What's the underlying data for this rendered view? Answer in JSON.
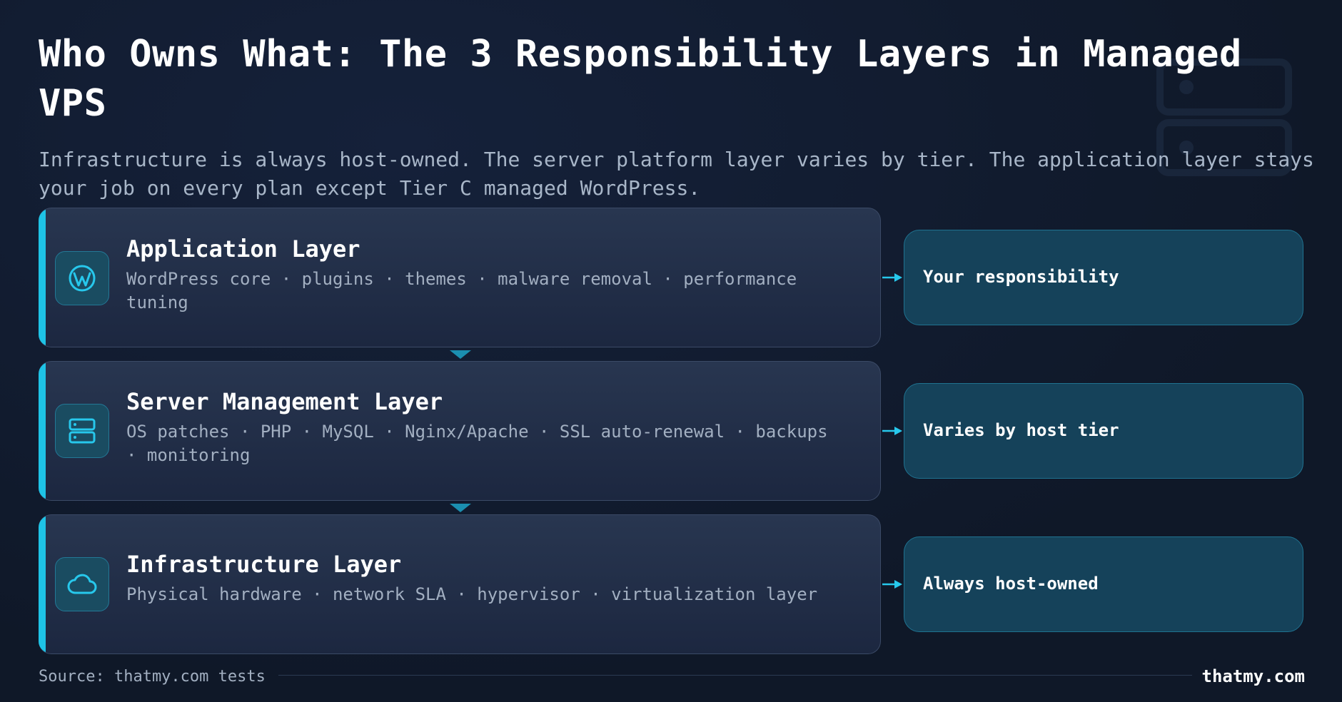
{
  "title": "Who Owns What: The 3 Responsibility Layers in Managed VPS",
  "subtitle": "Infrastructure is always host-owned. The server platform layer varies by tier. The application layer stays your job on every plan except Tier C managed WordPress.",
  "layers": [
    {
      "name": "Application Layer",
      "description": "WordPress core · plugins · themes · malware removal · performance tuning",
      "icon": "wordpress-icon",
      "owner": "Your responsibility"
    },
    {
      "name": "Server Management Layer",
      "description": "OS patches · PHP · MySQL · Nginx/Apache · SSL auto-renewal · backups · monitoring",
      "icon": "server-icon",
      "owner": "Varies by host tier"
    },
    {
      "name": "Infrastructure Layer",
      "description": "Physical hardware · network SLA · hypervisor · virtualization layer",
      "icon": "cloud-icon",
      "owner": "Always host-owned"
    }
  ],
  "footer": {
    "source": "Source: thatmy.com tests",
    "brand": "thatmy.com"
  },
  "colors": {
    "accent": "#1ec3e6",
    "background": "#101a2b",
    "card": "#232f48",
    "pill": "#15425a"
  }
}
